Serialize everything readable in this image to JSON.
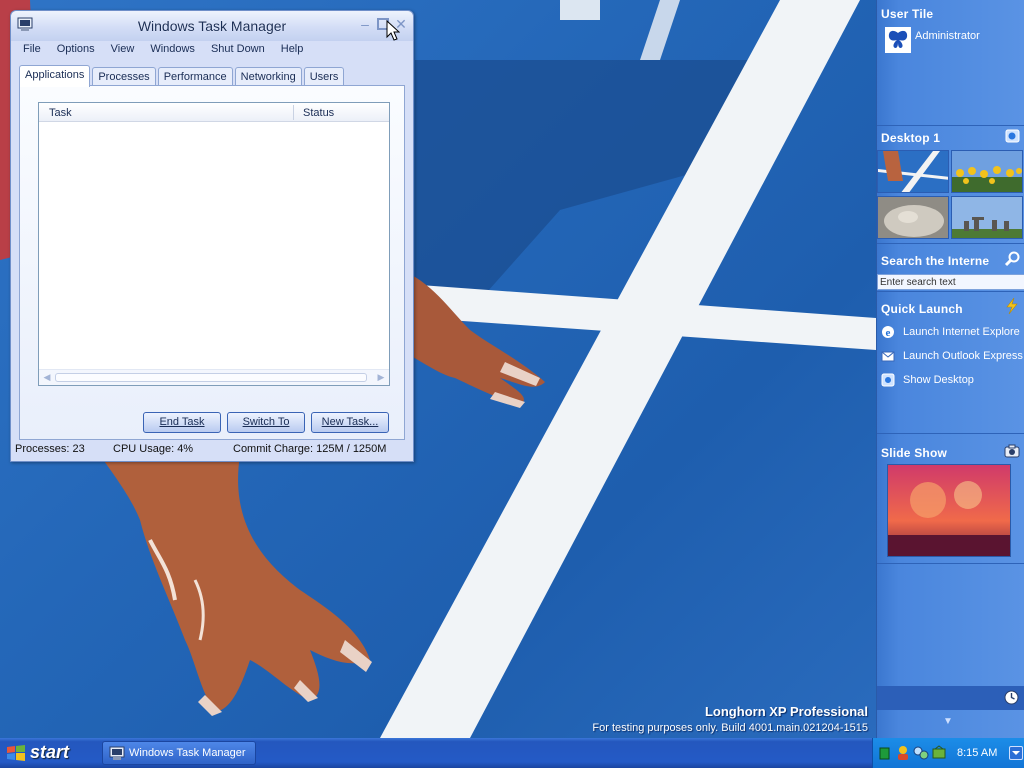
{
  "task_manager": {
    "title": "Windows Task Manager",
    "menu": [
      "File",
      "Options",
      "View",
      "Windows",
      "Shut Down",
      "Help"
    ],
    "tabs": [
      "Applications",
      "Processes",
      "Performance",
      "Networking",
      "Users"
    ],
    "active_tab": "Applications",
    "columns": [
      "Task",
      "Status"
    ],
    "tasks": [],
    "buttons": {
      "end_task": "End Task",
      "switch_to": "Switch To",
      "new_task": "New Task..."
    },
    "status": {
      "processes": "Processes: 23",
      "cpu": "CPU Usage: 4%",
      "commit": "Commit Charge: 125M / 1250M"
    }
  },
  "sidebar": {
    "user_tile": {
      "title": "User Tile",
      "user": "Administrator"
    },
    "desktop": {
      "title": "Desktop 1"
    },
    "search": {
      "title": "Search the Interne",
      "placeholder": "Enter search text"
    },
    "quick_launch": {
      "title": "Quick Launch",
      "items": [
        "Launch Internet Explore",
        "Launch Outlook Express",
        "Show Desktop"
      ]
    },
    "slide_show": {
      "title": "Slide Show"
    }
  },
  "watermark": {
    "title": "Longhorn XP Professional",
    "subtitle": "For testing purposes only. Build 4001.main.021204-1515"
  },
  "taskbar": {
    "start_label": "start",
    "task_button": "Windows Task Manager",
    "clock": "8:15 AM"
  },
  "colors": {
    "wallpaper_blue": "#2467b8",
    "sidebar_blue": "#4a86dd",
    "taskbar_blue": "#245ac6",
    "tray_blue": "#1275d6"
  }
}
